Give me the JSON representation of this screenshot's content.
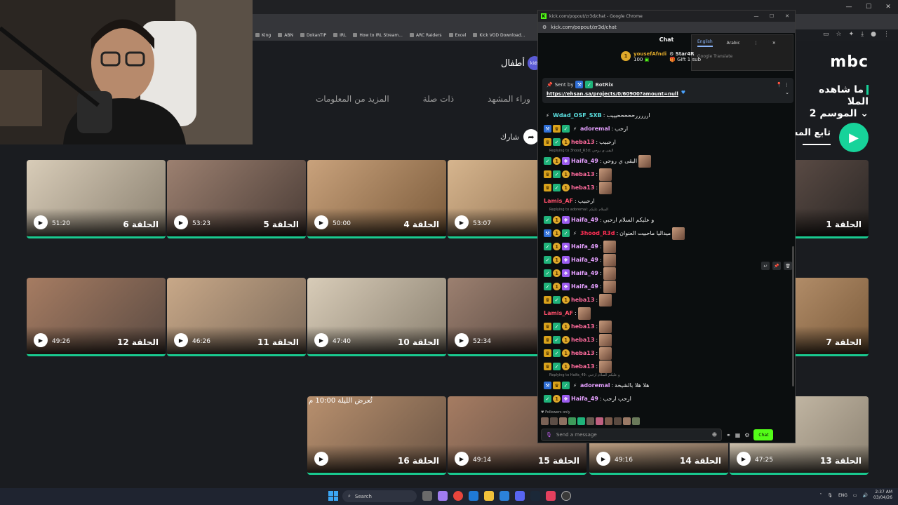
{
  "bookmarks": [
    "King",
    "ABN",
    "DokanTIP",
    "IRL",
    "How to IRL Stream...",
    "ARC Raiders",
    "Excel",
    "Kick VOD Download..."
  ],
  "mbc": {
    "logo": "mbc",
    "kids_label": "أطفال",
    "kids_badge": "kids",
    "show_title_line1": "ما شاهده الملا",
    "show_title_line2": "الموسم 2",
    "tabs": [
      "المزيد من المعلومات",
      "ذات صلة",
      "وراء المشهد"
    ],
    "share_label": "شارك",
    "follow_label": "تابع المش",
    "tonight_label": "تُعرض الليلة 10:00 م"
  },
  "episodes_row1": [
    {
      "title": "الحلقة 6",
      "duration": "51:20"
    },
    {
      "title": "الحلقة 5",
      "duration": "53:23"
    },
    {
      "title": "الحلقة 4",
      "duration": "50:00"
    },
    {
      "title": "",
      "duration": "53:07"
    },
    {
      "title": "الحلقة 1",
      "duration": ""
    }
  ],
  "episodes_row2": [
    {
      "title": "الحلقة 12",
      "duration": "49:26"
    },
    {
      "title": "الحلقة 11",
      "duration": "46:26"
    },
    {
      "title": "الحلقة 10",
      "duration": "47:40"
    },
    {
      "title": "",
      "duration": "52:34"
    },
    {
      "title": "الحلقة 7",
      "duration": ""
    }
  ],
  "episodes_row3": [
    {
      "title": "الحلقة 16",
      "duration": ""
    },
    {
      "title": "الحلقة 15",
      "duration": "49:14"
    },
    {
      "title": "الحلقة 14",
      "duration": "49:16"
    },
    {
      "title": "الحلقة 13",
      "duration": "47:25"
    }
  ],
  "chat_window": {
    "title": "kick.com/popout/zr3d/chat - Google Chrome",
    "url": "kick.com/popout/zr3d/chat",
    "header": "Chat",
    "translate_en": "English",
    "translate_ar": "Arabic",
    "translate_gt": "Google Translate",
    "gift_user": "yousefAfndi",
    "gift_amount": "100",
    "gift_target": "Star4R",
    "gift_text": "Gift 1 sub",
    "pinned_sent_by": "Sent by",
    "pinned_bot": "BotRix",
    "pinned_link": "https://ehsan.sa/projects/0/60900?amount=null",
    "followers_only": "Followers only",
    "input_placeholder": "Send a message",
    "send_label": "Chat"
  },
  "messages": [
    {
      "type": "msg",
      "badges": [
        "tool"
      ],
      "user": "Wdad_OSF_SXB",
      "color": "#5be0e0",
      "text": "ارررررحححححيييب",
      "emotes": 0
    },
    {
      "type": "msg",
      "badges": [
        "mod",
        "crown",
        "ver",
        "tool"
      ],
      "user": "adoremal",
      "color": "#e5a0ff",
      "text": "ارحب",
      "emotes": 0
    },
    {
      "type": "msg",
      "badges": [
        "crown",
        "ver",
        "coin"
      ],
      "user": "heba13",
      "color": "#ff6b9d",
      "text": "ارحبيب",
      "emotes": 0
    },
    {
      "type": "reply",
      "text": "Replying to 3hood_R3d: البقى ي روحي"
    },
    {
      "type": "msg",
      "badges": [
        "ver",
        "coin",
        "gift"
      ],
      "user": "Haifa_49",
      "color": "#e5a0ff",
      "text": "البقى ي روحي",
      "emotes": 1
    },
    {
      "type": "msg",
      "badges": [
        "crown",
        "ver",
        "coin"
      ],
      "user": "heba13",
      "color": "#ff6b9d",
      "text": "",
      "emotes": 1
    },
    {
      "type": "msg",
      "badges": [
        "crown",
        "ver",
        "coin"
      ],
      "user": "heba13",
      "color": "#ff6b9d",
      "text": "",
      "emotes": 1
    },
    {
      "type": "msg",
      "badges": [],
      "user": "Lamis_AF",
      "color": "#ff4f6b",
      "text": "ارحبيب",
      "emotes": 0
    },
    {
      "type": "reply",
      "text": "Replying to adoremal: السلام عليكم"
    },
    {
      "type": "msg",
      "badges": [
        "ver",
        "coin",
        "gift"
      ],
      "user": "Haifa_49",
      "color": "#e5a0ff",
      "text": "و عليكم السلام ارحبي",
      "emotes": 0
    },
    {
      "type": "msg",
      "badges": [
        "mod",
        "coin",
        "ver",
        "tool"
      ],
      "user": "3hood_R3d",
      "color": "#ff2e54",
      "text": "ميداليا ماحبيت العنوان",
      "emotes": 1
    },
    {
      "type": "msg",
      "badges": [
        "ver",
        "coin",
        "gift"
      ],
      "user": "Haifa_49",
      "color": "#e5a0ff",
      "text": "",
      "emotes": 1
    },
    {
      "type": "msg",
      "badges": [
        "ver",
        "coin",
        "gift"
      ],
      "user": "Haifa_49",
      "color": "#e5a0ff",
      "text": "",
      "emotes": 1
    },
    {
      "type": "msg",
      "badges": [
        "ver",
        "coin",
        "gift"
      ],
      "user": "Haifa_49",
      "color": "#e5a0ff",
      "text": "",
      "emotes": 1
    },
    {
      "type": "msg",
      "badges": [
        "ver",
        "coin",
        "gift"
      ],
      "user": "Haifa_49",
      "color": "#e5a0ff",
      "text": "",
      "emotes": 1
    },
    {
      "type": "msg",
      "badges": [
        "crown",
        "ver",
        "coin"
      ],
      "user": "heba13",
      "color": "#ff6b9d",
      "text": "",
      "emotes": 1
    },
    {
      "type": "msg",
      "badges": [],
      "user": "Lamis_AF",
      "color": "#ff4f6b",
      "text": "",
      "emotes": 1
    },
    {
      "type": "msg",
      "badges": [
        "crown",
        "ver",
        "coin"
      ],
      "user": "heba13",
      "color": "#ff6b9d",
      "text": "",
      "emotes": 1
    },
    {
      "type": "msg",
      "badges": [
        "crown",
        "ver",
        "coin"
      ],
      "user": "heba13",
      "color": "#ff6b9d",
      "text": "",
      "emotes": 1
    },
    {
      "type": "msg",
      "badges": [
        "crown",
        "ver",
        "coin"
      ],
      "user": "heba13",
      "color": "#ff6b9d",
      "text": "",
      "emotes": 1
    },
    {
      "type": "msg",
      "badges": [
        "crown",
        "ver",
        "coin"
      ],
      "user": "heba13",
      "color": "#ff6b9d",
      "text": "",
      "emotes": 1
    },
    {
      "type": "reply",
      "text": "Replying to Haifa_49: و عليكم السلام ارحبي"
    },
    {
      "type": "msg",
      "badges": [
        "mod",
        "crown",
        "ver",
        "tool"
      ],
      "user": "adoremal",
      "color": "#e5a0ff",
      "text": "هلا هلا بالشيخة",
      "emotes": 0
    },
    {
      "type": "msg",
      "badges": [
        "ver",
        "coin",
        "gift"
      ],
      "user": "Haifa_49",
      "color": "#e5a0ff",
      "text": "ارحب ارحب",
      "emotes": 0
    }
  ],
  "taskbar": {
    "search": "Search",
    "lang": "ENG",
    "time": "2:37 AM",
    "date": "03/04/26"
  }
}
